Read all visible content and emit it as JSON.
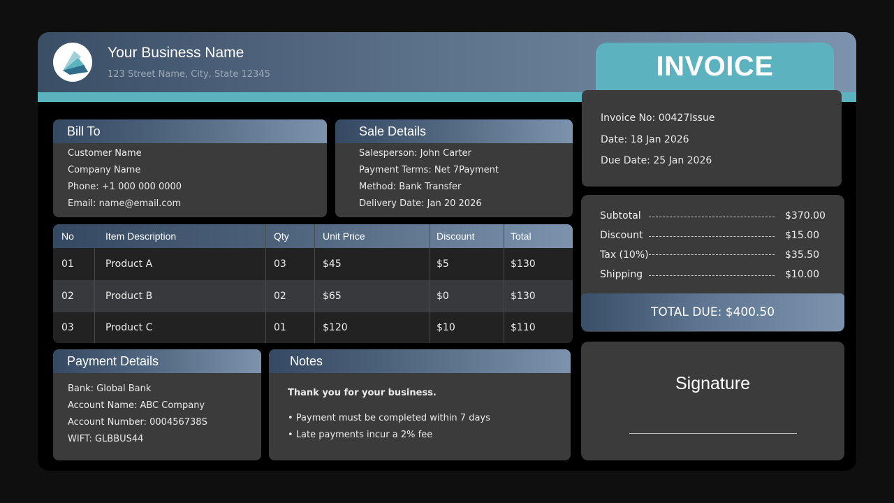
{
  "header": {
    "business_name": "Your Business Name",
    "address": "123 Street Name, City, State 12345",
    "logo_icon": "stacked-paper-logo-icon",
    "invoice_title": "INVOICE"
  },
  "invoice_info": {
    "number": "Invoice No: 00427Issue",
    "date": "Date: 18 Jan 2026",
    "due_date": "Due Date: 25 Jan 2026"
  },
  "bill_to": {
    "title": "Bill To",
    "lines": [
      "Customer Name",
      "Company Name",
      "Phone: +1 000 000 0000",
      "Email: name@email.com"
    ]
  },
  "sale_details": {
    "title": "Sale Details",
    "lines": [
      "Salesperson: John Carter",
      "Payment Terms: Net 7Payment",
      "Method: Bank Transfer",
      "Delivery Date: Jan 20 2026"
    ]
  },
  "items_table": {
    "headers": [
      "No",
      "Item Description",
      "Qty",
      "Unit Price",
      "Discount",
      "Total"
    ],
    "rows": [
      [
        "01",
        "Product A",
        "03",
        "$45",
        "$5",
        "$130"
      ],
      [
        "02",
        "Product B",
        "02",
        "$65",
        "$0",
        "$130"
      ],
      [
        "03",
        "Product C",
        "01",
        "$120",
        "$10",
        "$110"
      ]
    ]
  },
  "summary": {
    "rows": [
      {
        "label": "Subtotal",
        "value": "$370.00"
      },
      {
        "label": "Discount",
        "value": "$15.00"
      },
      {
        "label": "Tax (10%)",
        "value": "$35.50"
      },
      {
        "label": "Shipping",
        "value": "$10.00"
      }
    ],
    "total_due": "TOTAL DUE: $400.50"
  },
  "payment_details": {
    "title": "Payment Details",
    "lines": [
      "Bank: Global Bank",
      "Account Name: ABC Company",
      "Account Number: 000456738S",
      "WIFT: GLBBUS44"
    ]
  },
  "notes": {
    "title": "Notes",
    "heading": "Thank you for your business.",
    "bullets": [
      "• Payment must be completed within 7 days",
      "• Late payments incur a 2% fee"
    ]
  },
  "signature": {
    "title": "Signature"
  },
  "colors": {
    "accent_teal": "#5cb3bf",
    "header_blue_dark": "#354a62",
    "header_blue_light": "#7b93ad",
    "panel_bg": "#3b3b3c"
  }
}
